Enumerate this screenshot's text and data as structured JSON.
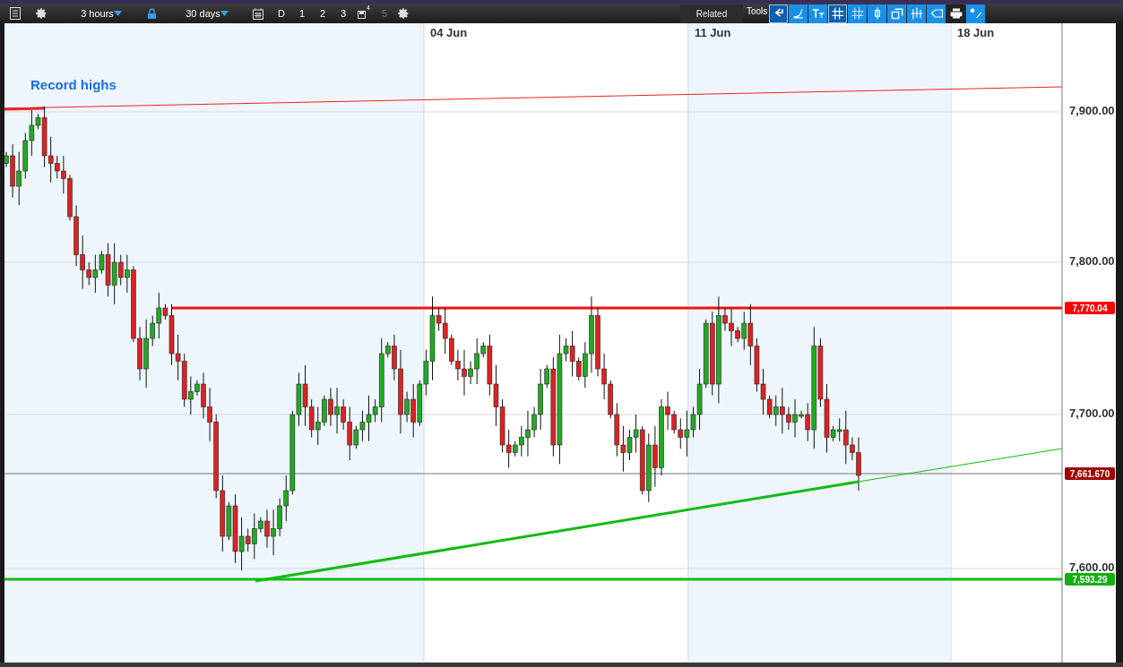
{
  "toolbar": {
    "interval": "3 hours",
    "range": "30 days",
    "periods": [
      {
        "label": "D",
        "kind": "text",
        "disabled": false
      },
      {
        "label": "1",
        "kind": "text",
        "disabled": false
      },
      {
        "label": "2",
        "kind": "text",
        "disabled": false
      },
      {
        "label": "3",
        "kind": "text",
        "disabled": false
      },
      {
        "label": "4",
        "kind": "badge",
        "disabled": false
      },
      {
        "label": "5",
        "kind": "text",
        "disabled": true
      }
    ],
    "related": "Related",
    "tools_label": "Tools"
  },
  "chart": {
    "annotation": "Record highs",
    "dates": [
      "04 Jun",
      "11 Jun",
      "18 Jun"
    ],
    "prices": [
      "7,900.00",
      "7,800.00",
      "7,700.00",
      "7,600.00"
    ],
    "price_tags": [
      {
        "label": "7,770.04",
        "color": "#ff0000"
      },
      {
        "label": "7,661.670",
        "color": "#a00000"
      },
      {
        "label": "7,593.29",
        "color": "#12b012"
      }
    ]
  }
}
